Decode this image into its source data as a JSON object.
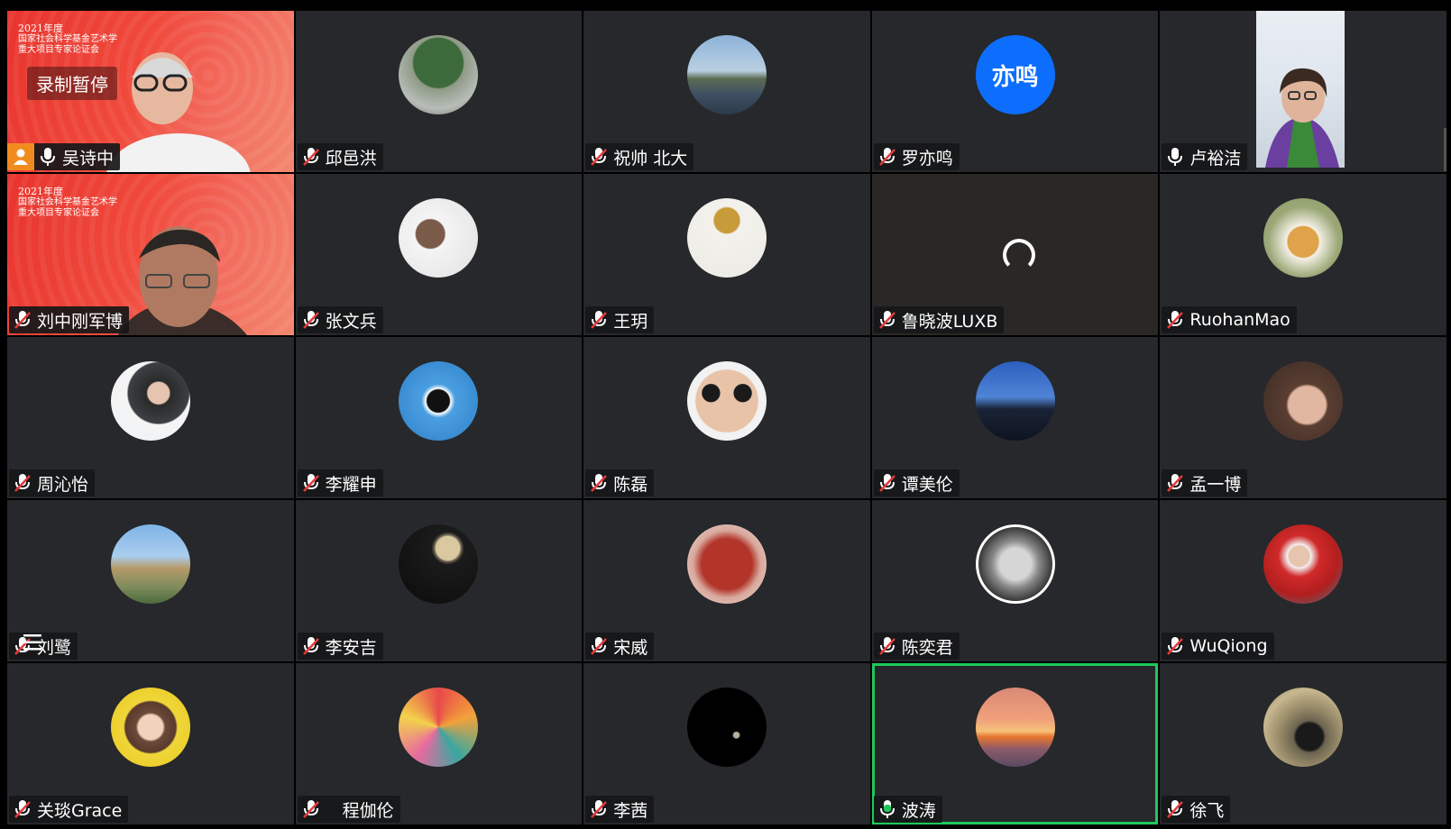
{
  "recording_status": "录制暂停",
  "banner_lines": [
    "2021年度",
    "国家社会科学基金艺术学",
    "重大项目专家论证会"
  ],
  "colors": {
    "speaking_border": "#1ec95a",
    "host_badge": "#f28b1f",
    "text_avatar": "#0d6efd",
    "muted_mic": "#ffffff",
    "active_mic": "#1ec95a"
  },
  "participants": [
    {
      "name": "吴诗中",
      "mic": "unmuted",
      "video": "on",
      "host": true
    },
    {
      "name": "邱邑洪",
      "mic": "muted",
      "avatar": "tree-courtyard-photo"
    },
    {
      "name": "祝帅 北大",
      "mic": "muted",
      "avatar": "lake-pagoda-photo"
    },
    {
      "name": "罗亦鸣",
      "mic": "muted",
      "avatar_text": "亦鸣"
    },
    {
      "name": "卢裕洁",
      "mic": "unmuted",
      "video": "on"
    },
    {
      "name": "刘中刚军博",
      "mic": "muted",
      "video": "on"
    },
    {
      "name": "张文兵",
      "mic": "muted",
      "avatar": "man-portrait-photo"
    },
    {
      "name": "王玥",
      "mic": "muted",
      "avatar": "lamp-photo"
    },
    {
      "name": "鲁晓波LUXB",
      "mic": "muted",
      "status": "loading"
    },
    {
      "name": "RuohanMao",
      "mic": "muted",
      "avatar": "cartoon-bear-photo"
    },
    {
      "name": "周沁怡",
      "mic": "muted",
      "avatar": "woman-portrait-photo"
    },
    {
      "name": "李耀申",
      "mic": "muted",
      "avatar": "orca-photo"
    },
    {
      "name": "陈磊",
      "mic": "muted",
      "avatar": "sunglasses-face-photo"
    },
    {
      "name": "谭美伦",
      "mic": "muted",
      "avatar": "dusk-silhouette-photo"
    },
    {
      "name": "孟一博",
      "mic": "muted",
      "avatar": "young-man-photo"
    },
    {
      "name": "刘鹭",
      "mic": "muted",
      "avatar": "building-photo"
    },
    {
      "name": "李安吉",
      "mic": "muted",
      "avatar": "planet-photo"
    },
    {
      "name": "宋威",
      "mic": "muted",
      "avatar": "red-seal-photo"
    },
    {
      "name": "陈奕君",
      "mic": "muted",
      "avatar": "fornasetti-face-photo"
    },
    {
      "name": "WuQiong",
      "mic": "muted",
      "avatar": "red-coat-photo"
    },
    {
      "name": "关琰Grace",
      "mic": "muted",
      "avatar": "cartoon-girl-photo"
    },
    {
      "name": "程伽伦",
      "mic": "muted",
      "avatar": "colorful-faces-photo"
    },
    {
      "name": "李茜",
      "mic": "muted",
      "avatar": "black-moon-photo"
    },
    {
      "name": "波涛",
      "mic": "active",
      "avatar": "sunset-photo",
      "speaking": true
    },
    {
      "name": "徐飞",
      "mic": "muted",
      "avatar": "bird-photo"
    }
  ]
}
